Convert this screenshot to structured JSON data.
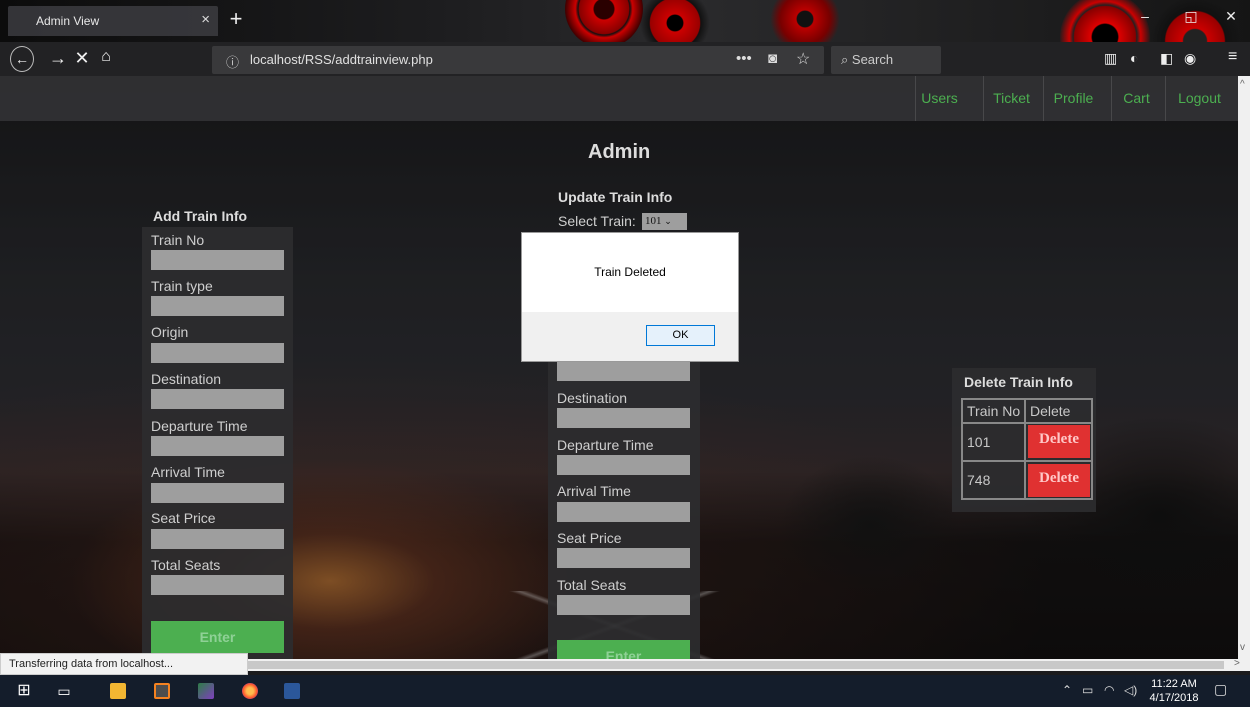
{
  "browser": {
    "tab_title": "Admin View",
    "tab_close": "×",
    "new_tab": "+",
    "url_info": "ⓘ",
    "url": "localhost/RSS/addtrainview.php",
    "search_placeholder": "Search",
    "window_min": "–",
    "window_max": "◱",
    "window_close": "✕"
  },
  "nav": {
    "items": [
      {
        "label": "Users"
      },
      {
        "label": "Ticket"
      },
      {
        "label": "Profile"
      },
      {
        "label": "Cart"
      },
      {
        "label": "Logout"
      }
    ],
    "accent": "#4caf50"
  },
  "page": {
    "title": "Admin"
  },
  "add_form": {
    "heading": "Add Train Info",
    "fields": [
      {
        "label": "Train No"
      },
      {
        "label": "Train type"
      },
      {
        "label": "Origin"
      },
      {
        "label": "Destination"
      },
      {
        "label": "Departure Time"
      },
      {
        "label": "Arrival Time"
      },
      {
        "label": "Seat Price"
      },
      {
        "label": "Total Seats"
      }
    ],
    "submit_label": "Enter"
  },
  "update_form": {
    "heading": "Update Train Info",
    "select_label": "Select Train:",
    "selected_train": "101",
    "fields": [
      {
        "label": "Destination"
      },
      {
        "label": "Departure Time"
      },
      {
        "label": "Arrival Time"
      },
      {
        "label": "Seat Price"
      },
      {
        "label": "Total Seats"
      }
    ],
    "submit_label": "Enter"
  },
  "delete_table": {
    "heading": "Delete Train Info",
    "columns": [
      "Train No",
      "Delete"
    ],
    "rows": [
      {
        "train_no": "101",
        "action": "Delete"
      },
      {
        "train_no": "748",
        "action": "Delete"
      }
    ],
    "button_color": "#e03131"
  },
  "dialog": {
    "message": "Train Deleted",
    "ok_label": "OK"
  },
  "status_bar": {
    "text": "Transferring data from localhost..."
  },
  "taskbar": {
    "time": "11:22 AM",
    "date": "4/17/2018"
  }
}
